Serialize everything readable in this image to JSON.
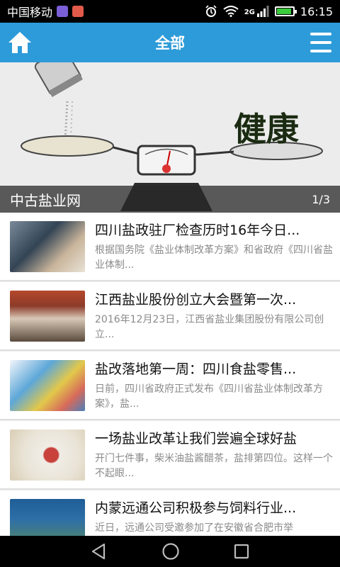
{
  "status_bar": {
    "carrier": "中国移动",
    "network": "2G",
    "time": "16:15"
  },
  "header": {
    "title": "全部",
    "left_icon": "home-icon",
    "right_icon": "menu-icon"
  },
  "banner": {
    "caption": "中古盐业网",
    "pager": "1/3",
    "image_text": "健康"
  },
  "news": [
    {
      "title": "四川盐政驻厂检查历时16年今日...",
      "desc": "根据国务院《盐业体制改革方案》和省政府《四川省盐业体制..."
    },
    {
      "title": "江西盐业股份创立大会暨第一次...",
      "desc": "2016年12月23日，江西省盐业集团股份有限公司创立..."
    },
    {
      "title": "盐改落地第一周：四川食盐零售...",
      "desc": "日前，四川省政府正式发布《四川省盐业体制改革方案》，盐..."
    },
    {
      "title": "一场盐业改革让我们尝遍全球好盐",
      "desc": "开门七件事，柴米油盐酱醋茶，盐排第四位。这样一个不起眼..."
    },
    {
      "title": "内蒙远通公司积极参与饲料行业...",
      "desc": "近日，远通公司受邀参加了在安徽省合肥市举"
    }
  ],
  "nav_bar": {
    "icons": [
      "back-icon",
      "home-circle-icon",
      "recents-icon"
    ]
  }
}
